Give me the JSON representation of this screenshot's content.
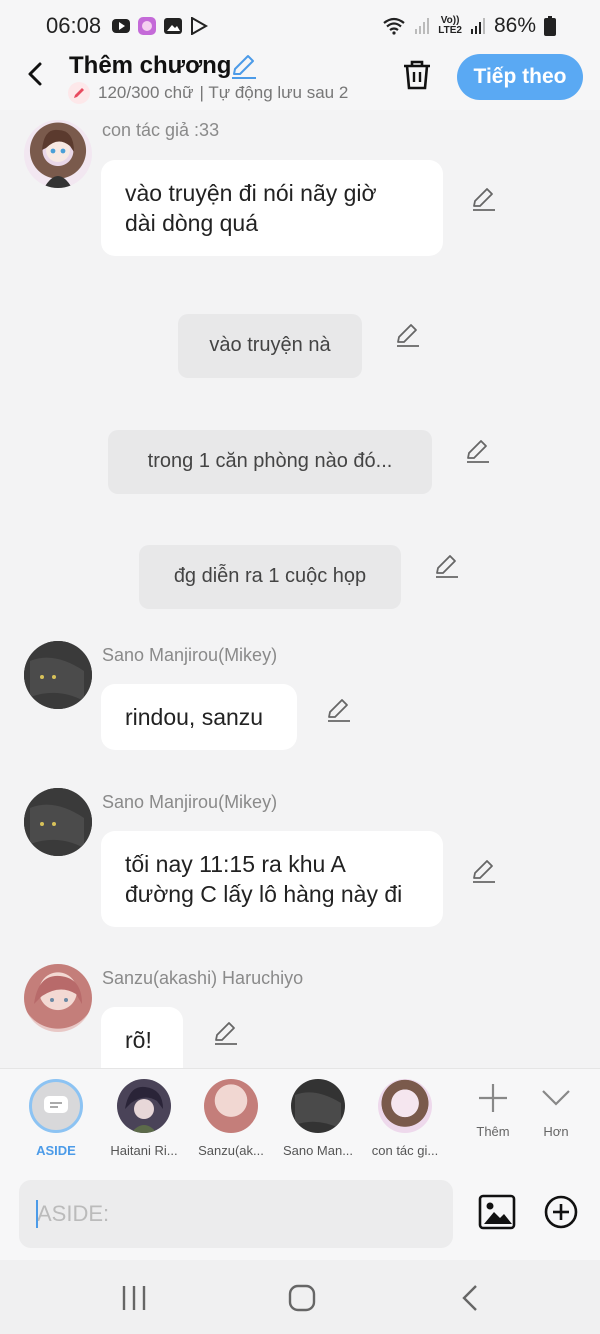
{
  "status_bar": {
    "time": "06:08",
    "battery": "86%",
    "network_label": "LTE2",
    "network_voice": "Vo))"
  },
  "header": {
    "title": "Thêm chương",
    "word_count": "120/300 chữ",
    "autosave": "| Tự động lưu sau 2",
    "next_label": "Tiếp theo",
    "accent": "#5aa9f3"
  },
  "messages": [
    {
      "type": "character",
      "name": "con tác giả :33",
      "text_lines": [
        "vào truyện đi nói nãy giờ",
        "dài dòng quá"
      ]
    },
    {
      "type": "aside",
      "text": "vào truyện nà"
    },
    {
      "type": "aside",
      "text": "trong 1 căn phòng nào đó..."
    },
    {
      "type": "aside",
      "text": "đg diễn ra 1 cuộc họp"
    },
    {
      "type": "character",
      "name": "Sano Manjirou(Mikey)",
      "text_lines": [
        "rindou, sanzu"
      ]
    },
    {
      "type": "character",
      "name": "Sano Manjirou(Mikey)",
      "text_lines": [
        "tối nay 11:15 ra khu A",
        "đường C lấy lô hàng này đi"
      ]
    },
    {
      "type": "character",
      "name": "Sanzu(akashi) Haruchiyo",
      "text_lines": [
        "rõ!"
      ]
    }
  ],
  "characters": [
    {
      "label": "ASIDE",
      "active": true
    },
    {
      "label": "Haitani Ri..."
    },
    {
      "label": "Sanzu(ak..."
    },
    {
      "label": "Sano Man..."
    },
    {
      "label": "con tác gi..."
    }
  ],
  "strip_tools": {
    "add_label": "Thêm",
    "more_label": "Hơn"
  },
  "input": {
    "placeholder": "ASIDE:"
  }
}
